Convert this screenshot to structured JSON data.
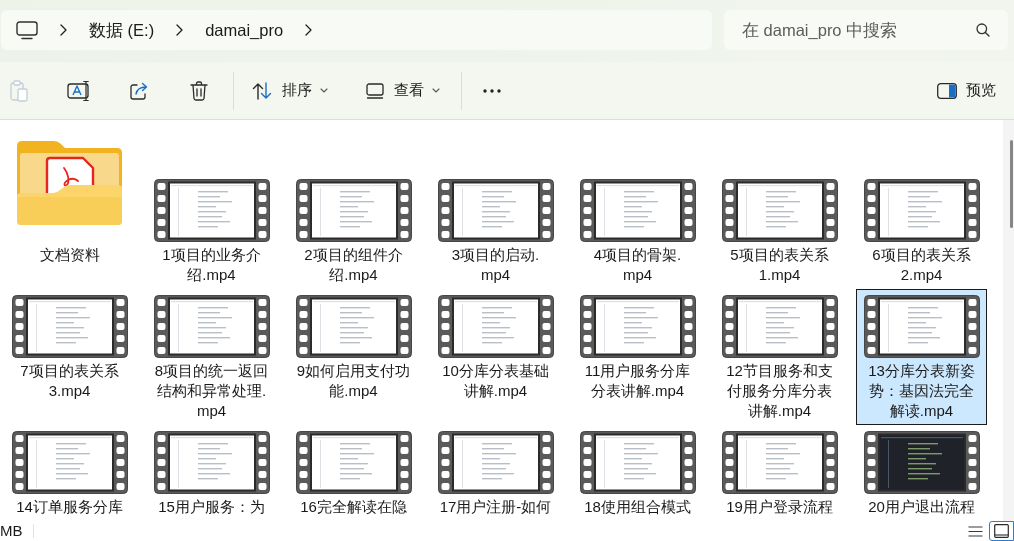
{
  "address_bar": {
    "breadcrumbs": [
      {
        "label": "数据 (E:)"
      },
      {
        "label": "damai_pro"
      }
    ]
  },
  "search": {
    "placeholder": "在 damai_pro 中搜索"
  },
  "toolbar": {
    "buttons": [
      {
        "kind": "paste",
        "disabled": true
      },
      {
        "kind": "rename",
        "disabled": false
      },
      {
        "kind": "share",
        "disabled": false
      },
      {
        "kind": "delete",
        "disabled": false
      }
    ],
    "menus": [
      {
        "kind": "sort",
        "label": "排序"
      },
      {
        "kind": "view",
        "label": "查看"
      }
    ],
    "preview": {
      "label": "预览"
    }
  },
  "files": [
    {
      "kind": "folder",
      "label": "文档资料",
      "selected": false
    },
    {
      "kind": "video",
      "label": "1项目的业务介绍.mp4",
      "selected": false,
      "dark": false
    },
    {
      "kind": "video",
      "label": "2项目的组件介绍.mp4",
      "selected": false,
      "dark": false
    },
    {
      "kind": "video",
      "label": "3项目的启动.mp4",
      "selected": false,
      "dark": false
    },
    {
      "kind": "video",
      "label": "4项目的骨架.mp4",
      "selected": false,
      "dark": false
    },
    {
      "kind": "video",
      "label": "5项目的表关系1.mp4",
      "selected": false,
      "dark": false
    },
    {
      "kind": "video",
      "label": "6项目的表关系2.mp4",
      "selected": false,
      "dark": false
    },
    {
      "kind": "video",
      "label": "7项目的表关系3.mp4",
      "selected": false,
      "dark": false
    },
    {
      "kind": "video",
      "label": "8项目的统一返回结构和异常处理.mp4",
      "selected": false,
      "dark": false
    },
    {
      "kind": "video",
      "label": "9如何启用支付功能.mp4",
      "selected": false,
      "dark": false
    },
    {
      "kind": "video",
      "label": "10分库分表基础讲解.mp4",
      "selected": false,
      "dark": false
    },
    {
      "kind": "video",
      "label": "11用户服务分库分表讲解.mp4",
      "selected": false,
      "dark": false
    },
    {
      "kind": "video",
      "label": "12节目服务和支付服务分库分表讲解.mp4",
      "selected": false,
      "dark": false
    },
    {
      "kind": "video",
      "label": "13分库分表新姿势：基因法完全解读.mp4",
      "selected": true,
      "dark": false
    },
    {
      "kind": "video",
      "label": "14订单服务分库",
      "selected": false,
      "dark": false
    },
    {
      "kind": "video",
      "label": "15用户服务：为",
      "selected": false,
      "dark": false
    },
    {
      "kind": "video",
      "label": "16完全解读在隐",
      "selected": false,
      "dark": false
    },
    {
      "kind": "video",
      "label": "17用户注册-如何",
      "selected": false,
      "dark": false
    },
    {
      "kind": "video",
      "label": "18使用组合模式",
      "selected": false,
      "dark": false
    },
    {
      "kind": "video",
      "label": "19用户登录流程",
      "selected": false,
      "dark": false
    },
    {
      "kind": "video",
      "label": "20用户退出流程",
      "selected": false,
      "dark": true
    }
  ],
  "status_bar": {
    "text": "MB",
    "views": [
      {
        "kind": "details",
        "selected": false
      },
      {
        "kind": "large-icons",
        "selected": true
      }
    ]
  }
}
